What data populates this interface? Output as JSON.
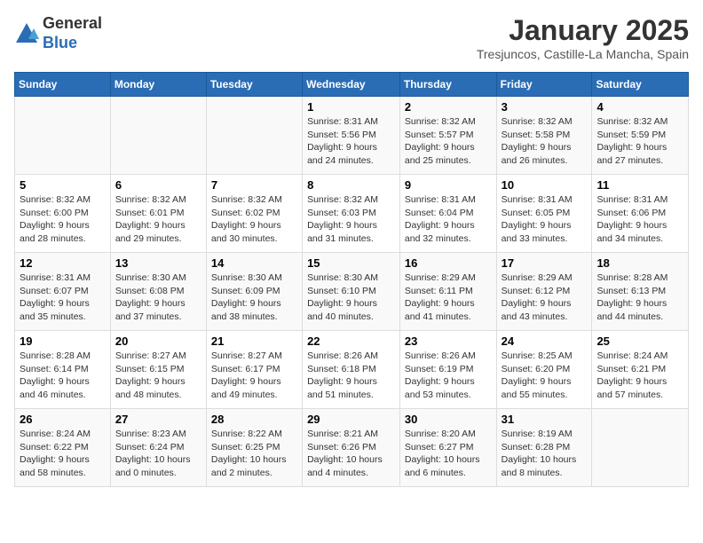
{
  "header": {
    "logo_line1": "General",
    "logo_line2": "Blue",
    "month_title": "January 2025",
    "subtitle": "Tresjuncos, Castille-La Mancha, Spain"
  },
  "days_of_week": [
    "Sunday",
    "Monday",
    "Tuesday",
    "Wednesday",
    "Thursday",
    "Friday",
    "Saturday"
  ],
  "weeks": [
    [
      {
        "day": "",
        "info": ""
      },
      {
        "day": "",
        "info": ""
      },
      {
        "day": "",
        "info": ""
      },
      {
        "day": "1",
        "info": "Sunrise: 8:31 AM\nSunset: 5:56 PM\nDaylight: 9 hours\nand 24 minutes."
      },
      {
        "day": "2",
        "info": "Sunrise: 8:32 AM\nSunset: 5:57 PM\nDaylight: 9 hours\nand 25 minutes."
      },
      {
        "day": "3",
        "info": "Sunrise: 8:32 AM\nSunset: 5:58 PM\nDaylight: 9 hours\nand 26 minutes."
      },
      {
        "day": "4",
        "info": "Sunrise: 8:32 AM\nSunset: 5:59 PM\nDaylight: 9 hours\nand 27 minutes."
      }
    ],
    [
      {
        "day": "5",
        "info": "Sunrise: 8:32 AM\nSunset: 6:00 PM\nDaylight: 9 hours\nand 28 minutes."
      },
      {
        "day": "6",
        "info": "Sunrise: 8:32 AM\nSunset: 6:01 PM\nDaylight: 9 hours\nand 29 minutes."
      },
      {
        "day": "7",
        "info": "Sunrise: 8:32 AM\nSunset: 6:02 PM\nDaylight: 9 hours\nand 30 minutes."
      },
      {
        "day": "8",
        "info": "Sunrise: 8:32 AM\nSunset: 6:03 PM\nDaylight: 9 hours\nand 31 minutes."
      },
      {
        "day": "9",
        "info": "Sunrise: 8:31 AM\nSunset: 6:04 PM\nDaylight: 9 hours\nand 32 minutes."
      },
      {
        "day": "10",
        "info": "Sunrise: 8:31 AM\nSunset: 6:05 PM\nDaylight: 9 hours\nand 33 minutes."
      },
      {
        "day": "11",
        "info": "Sunrise: 8:31 AM\nSunset: 6:06 PM\nDaylight: 9 hours\nand 34 minutes."
      }
    ],
    [
      {
        "day": "12",
        "info": "Sunrise: 8:31 AM\nSunset: 6:07 PM\nDaylight: 9 hours\nand 35 minutes."
      },
      {
        "day": "13",
        "info": "Sunrise: 8:30 AM\nSunset: 6:08 PM\nDaylight: 9 hours\nand 37 minutes."
      },
      {
        "day": "14",
        "info": "Sunrise: 8:30 AM\nSunset: 6:09 PM\nDaylight: 9 hours\nand 38 minutes."
      },
      {
        "day": "15",
        "info": "Sunrise: 8:30 AM\nSunset: 6:10 PM\nDaylight: 9 hours\nand 40 minutes."
      },
      {
        "day": "16",
        "info": "Sunrise: 8:29 AM\nSunset: 6:11 PM\nDaylight: 9 hours\nand 41 minutes."
      },
      {
        "day": "17",
        "info": "Sunrise: 8:29 AM\nSunset: 6:12 PM\nDaylight: 9 hours\nand 43 minutes."
      },
      {
        "day": "18",
        "info": "Sunrise: 8:28 AM\nSunset: 6:13 PM\nDaylight: 9 hours\nand 44 minutes."
      }
    ],
    [
      {
        "day": "19",
        "info": "Sunrise: 8:28 AM\nSunset: 6:14 PM\nDaylight: 9 hours\nand 46 minutes."
      },
      {
        "day": "20",
        "info": "Sunrise: 8:27 AM\nSunset: 6:15 PM\nDaylight: 9 hours\nand 48 minutes."
      },
      {
        "day": "21",
        "info": "Sunrise: 8:27 AM\nSunset: 6:17 PM\nDaylight: 9 hours\nand 49 minutes."
      },
      {
        "day": "22",
        "info": "Sunrise: 8:26 AM\nSunset: 6:18 PM\nDaylight: 9 hours\nand 51 minutes."
      },
      {
        "day": "23",
        "info": "Sunrise: 8:26 AM\nSunset: 6:19 PM\nDaylight: 9 hours\nand 53 minutes."
      },
      {
        "day": "24",
        "info": "Sunrise: 8:25 AM\nSunset: 6:20 PM\nDaylight: 9 hours\nand 55 minutes."
      },
      {
        "day": "25",
        "info": "Sunrise: 8:24 AM\nSunset: 6:21 PM\nDaylight: 9 hours\nand 57 minutes."
      }
    ],
    [
      {
        "day": "26",
        "info": "Sunrise: 8:24 AM\nSunset: 6:22 PM\nDaylight: 9 hours\nand 58 minutes."
      },
      {
        "day": "27",
        "info": "Sunrise: 8:23 AM\nSunset: 6:24 PM\nDaylight: 10 hours\nand 0 minutes."
      },
      {
        "day": "28",
        "info": "Sunrise: 8:22 AM\nSunset: 6:25 PM\nDaylight: 10 hours\nand 2 minutes."
      },
      {
        "day": "29",
        "info": "Sunrise: 8:21 AM\nSunset: 6:26 PM\nDaylight: 10 hours\nand 4 minutes."
      },
      {
        "day": "30",
        "info": "Sunrise: 8:20 AM\nSunset: 6:27 PM\nDaylight: 10 hours\nand 6 minutes."
      },
      {
        "day": "31",
        "info": "Sunrise: 8:19 AM\nSunset: 6:28 PM\nDaylight: 10 hours\nand 8 minutes."
      },
      {
        "day": "",
        "info": ""
      }
    ]
  ]
}
